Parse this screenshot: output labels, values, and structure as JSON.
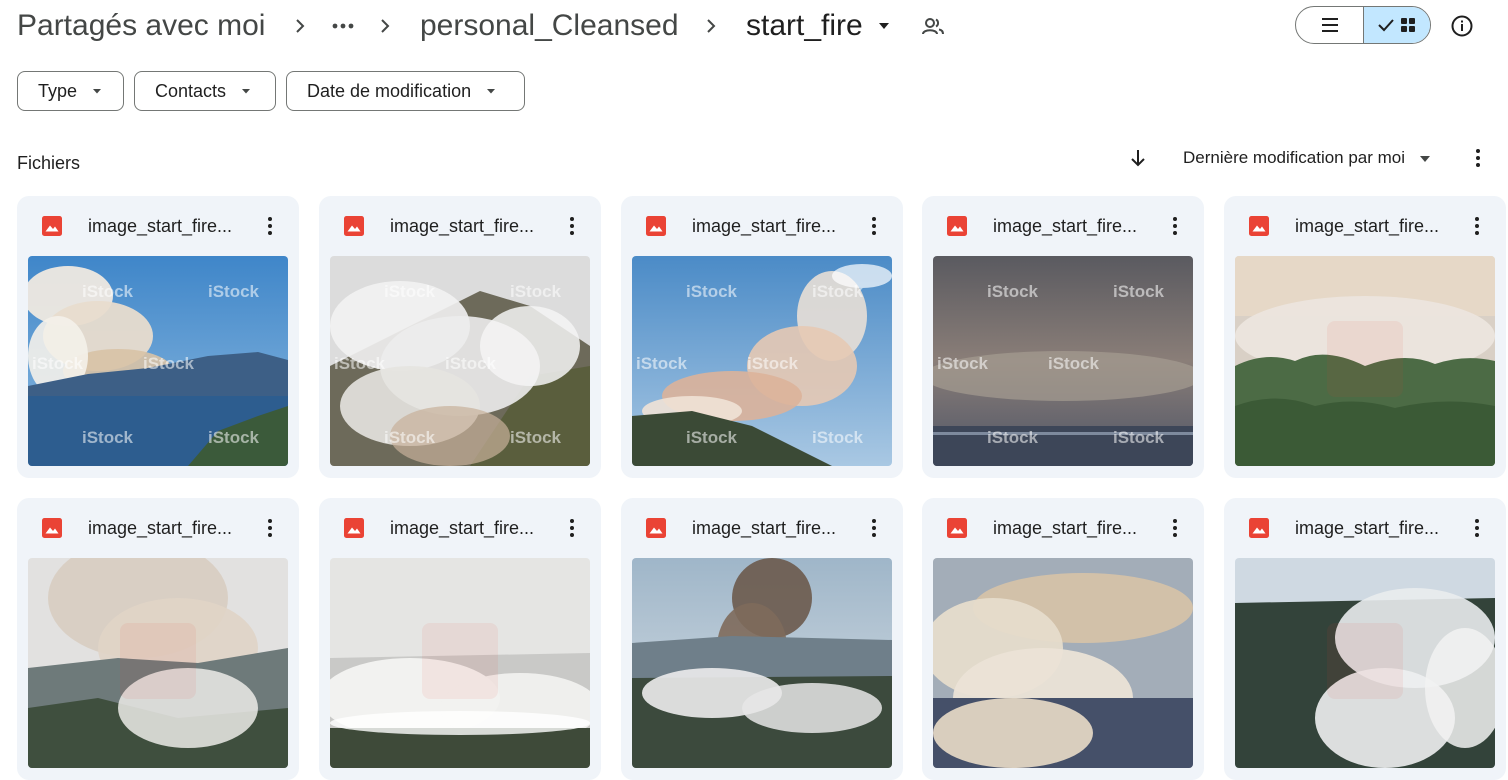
{
  "breadcrumb": {
    "root": "Partagés avec moi",
    "more": "...",
    "folder": "personal_Cleansed",
    "current": "start_fire"
  },
  "view": {
    "list_icon": "list-view-icon",
    "grid_icon": "grid-view-icon",
    "selected": "grid"
  },
  "filters": [
    {
      "label": "Type"
    },
    {
      "label": "Contacts"
    },
    {
      "label": "Date de modification"
    }
  ],
  "section": {
    "title": "Fichiers",
    "sort_label": "Dernière modification par moi",
    "sort_direction_icon": "arrow-down-icon"
  },
  "files": [
    {
      "name": "image_start_fire...",
      "thumb": "lake",
      "watermark": "iStock"
    },
    {
      "name": "image_start_fire...",
      "thumb": "hill",
      "watermark": "iStock"
    },
    {
      "name": "image_start_fire...",
      "thumb": "sky",
      "watermark": "iStock"
    },
    {
      "name": "image_start_fire...",
      "thumb": "dusk",
      "watermark": "iStock"
    },
    {
      "name": "image_start_fire...",
      "thumb": "forest",
      "watermark": ""
    },
    {
      "name": "image_start_fire...",
      "thumb": "valley",
      "watermark": ""
    },
    {
      "name": "image_start_fire...",
      "thumb": "haze",
      "watermark": ""
    },
    {
      "name": "image_start_fire...",
      "thumb": "column",
      "watermark": ""
    },
    {
      "name": "image_start_fire...",
      "thumb": "billow",
      "watermark": ""
    },
    {
      "name": "image_start_fire...",
      "thumb": "aerial",
      "watermark": ""
    }
  ],
  "colors": {
    "accent_selected": "#c2e7ff",
    "card_bg": "#f0f4f9",
    "image_icon": "#ea4335",
    "outline": "#747775"
  }
}
